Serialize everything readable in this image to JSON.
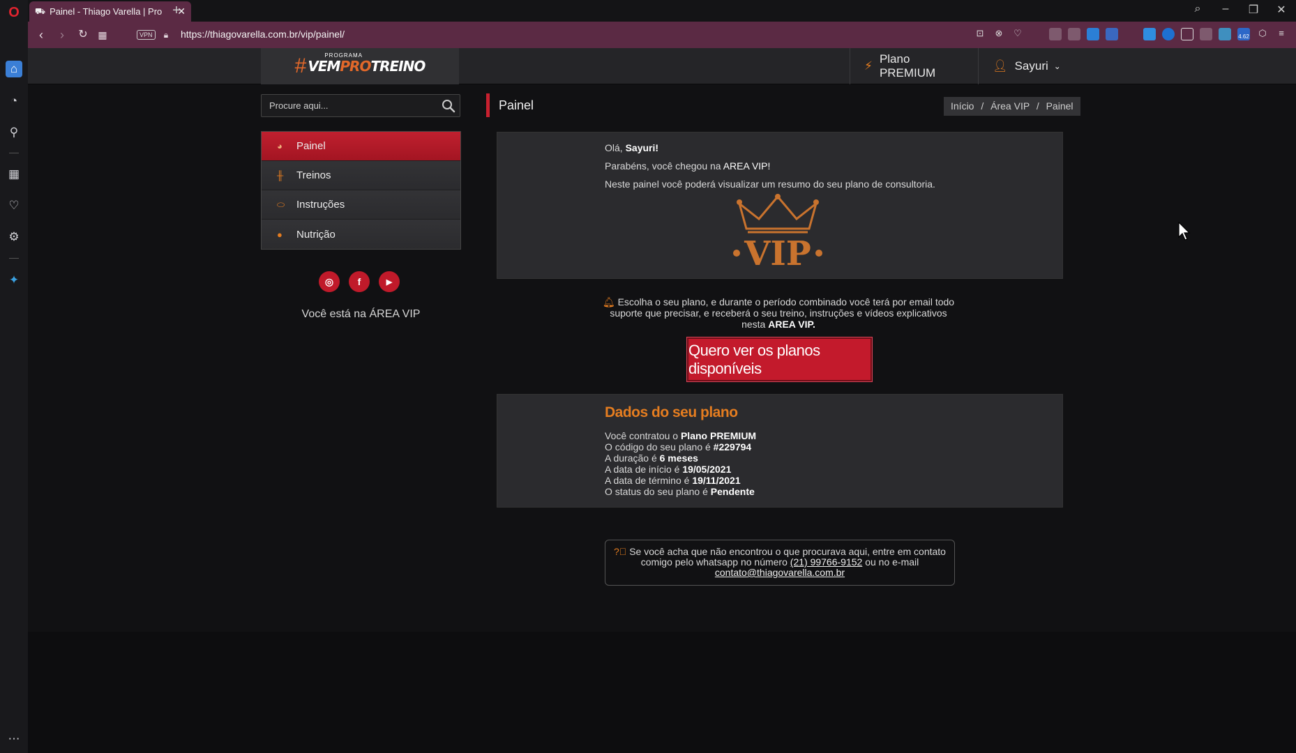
{
  "browser": {
    "tab_title": "Painel - Thiago Varella | Pro",
    "url": "https://thiagovarella.com.br/vip/painel/",
    "vpn_label": "VPN",
    "extension_badge": "4.62"
  },
  "header": {
    "logo": {
      "hash": "#",
      "programa": "PROGRAMA",
      "vem": "VEM",
      "pro": "PRO",
      "treino": "TREINO"
    },
    "plan_label": "Plano PREMIUM",
    "user_name": "Sayuri"
  },
  "sidebar": {
    "search_placeholder": "Procure aqui...",
    "menu": [
      {
        "label": "Painel",
        "icon": "dashboard-icon",
        "active": true
      },
      {
        "label": "Treinos",
        "icon": "dumbbell-icon",
        "active": false
      },
      {
        "label": "Instruções",
        "icon": "pill-icon",
        "active": false
      },
      {
        "label": "Nutrição",
        "icon": "apple-icon",
        "active": false
      }
    ],
    "socials": [
      "instagram-icon",
      "facebook-icon",
      "youtube-icon"
    ],
    "area_note": "Você está na ÁREA VIP"
  },
  "page": {
    "title": "Painel",
    "breadcrumb": [
      "Início",
      "Área VIP",
      "Painel"
    ]
  },
  "welcome": {
    "greeting_prefix": "Olá,",
    "greeting_name": "Sayuri!",
    "line2_prefix": "Parabéns, você chegou na",
    "line2_bold": "AREA VIP!",
    "line3": "Neste painel você poderá visualizar um resumo do seu plano de consultoria.",
    "vip_badge": "VIP"
  },
  "notice": {
    "line1": "Escolha o seu plano, e durante o período combinado você terá por email todo",
    "line2": "suporte que precisar, e receberá o seu treino, instruções e vídeos explicativos",
    "line3_prefix": "nesta",
    "line3_bold": "AREA VIP."
  },
  "cta_button": "Quero ver os planos disponíveis",
  "plan": {
    "title": "Dados do seu plano",
    "rows": [
      {
        "label": "Você contratou o",
        "value": "Plano PREMIUM"
      },
      {
        "label": "O código do seu plano é",
        "value": "#229794"
      },
      {
        "label": "A duração é",
        "value": "6 meses"
      },
      {
        "label": "A data de início é",
        "value": "19/05/2021"
      },
      {
        "label": "A data de término é",
        "value": "19/11/2021"
      },
      {
        "label": "O status do seu plano é",
        "value": "Pendente"
      }
    ]
  },
  "contact": {
    "line1": "Se você acha que não encontrou o que procurava aqui, entre em contato",
    "line2_prefix": "comigo pelo whatsapp no número",
    "phone": "(21) 99766-9152",
    "line2_suffix": "ou no e-mail",
    "email": "contato@thiagovarella.com.br"
  },
  "colors": {
    "accent_red": "#c31a2c",
    "accent_orange": "#e57d20",
    "browser_purple": "#5b2a44"
  }
}
